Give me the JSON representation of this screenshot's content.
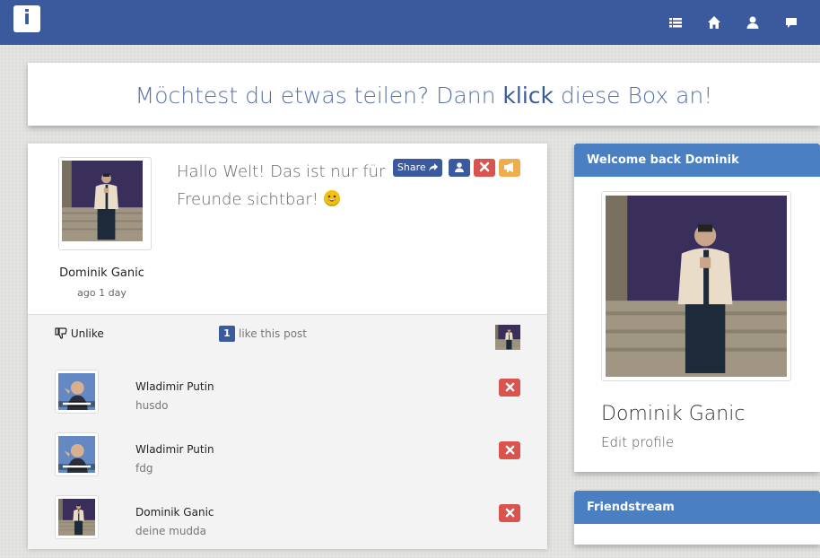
{
  "navbar": {
    "brand_letter": "i",
    "background": "#3b5a9e",
    "icons": [
      "list-icon",
      "home-icon",
      "user-icon",
      "chat-icon"
    ]
  },
  "share_prompt": {
    "before": "Möchtest du etwas teilen? Dann ",
    "strong": "klick",
    "after": " diese Box an!"
  },
  "post": {
    "author": "Dominik Ganic",
    "time": "ago 1 day",
    "text": "Hallo Welt! Das ist nur für Freunde sichtbar!",
    "emoji": "grinning-face-icon",
    "share_label": "Share",
    "unlike_label": "Unlike",
    "likes_count": "1",
    "likes_text": "like this post"
  },
  "comments": [
    {
      "author": "Wladimir Putin",
      "text": "husdo",
      "avatar": "putin-meme"
    },
    {
      "author": "Wladimir Putin",
      "text": "fdg",
      "avatar": "putin-meme"
    },
    {
      "author": "Dominik Ganic",
      "text": "deine mudda",
      "avatar": "dominik-photo"
    }
  ],
  "welcome": {
    "heading": "Welcome back Dominik",
    "name": "Dominik Ganic",
    "edit_profile": "Edit profile"
  },
  "friendstream": {
    "heading": "Friendstream"
  },
  "colors": {
    "primary": "#3b5a9e",
    "panel_heading": "#4a7fc1",
    "danger": "#d9534f",
    "warning": "#f0ad4e"
  }
}
